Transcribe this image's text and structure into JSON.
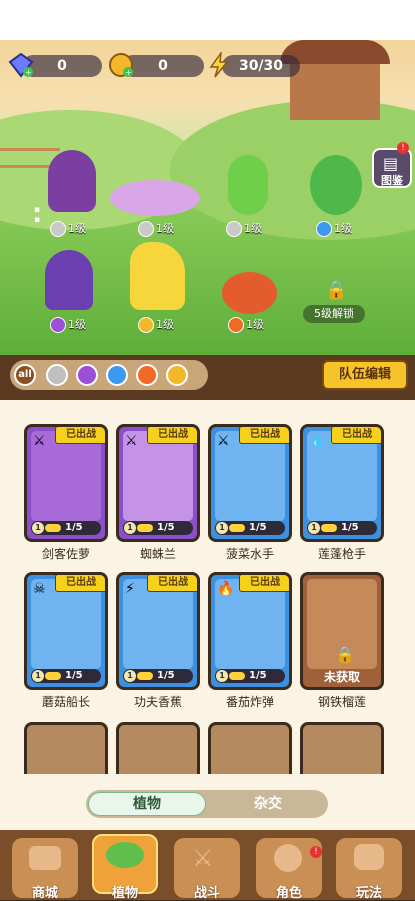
{
  "resources": {
    "diamonds": "0",
    "coins": "0",
    "energy": "30/30"
  },
  "scene": {
    "book_label": "图鉴",
    "lock_text": "5级解锁",
    "slots": [
      {
        "level": "1级",
        "element": "steel"
      },
      {
        "level": "1级",
        "element": "steel"
      },
      {
        "level": "1级",
        "element": "steel"
      },
      {
        "level": "1级",
        "element": "water"
      },
      {
        "level": "1级",
        "element": "poison"
      },
      {
        "level": "1级",
        "element": "electric"
      },
      {
        "level": "1级",
        "element": "fire"
      }
    ]
  },
  "filter": {
    "all_label": "all",
    "team_edit": "队伍编辑"
  },
  "cards": [
    {
      "name": "剑客佐萝",
      "tag": "已出战",
      "level": "1",
      "count": "1/5",
      "element": "steel",
      "color": "#8a4fc9"
    },
    {
      "name": "蜘蛛兰",
      "tag": "已出战",
      "level": "1",
      "count": "1/5",
      "element": "steel",
      "color": "#8a4fc9"
    },
    {
      "name": "菠菜水手",
      "tag": "已出战",
      "level": "1",
      "count": "1/5",
      "element": "steel",
      "color": "#3d8fe0"
    },
    {
      "name": "莲蓬枪手",
      "tag": "已出战",
      "level": "1",
      "count": "1/5",
      "element": "water",
      "color": "#3d8fe0"
    },
    {
      "name": "蘑菇船长",
      "tag": "已出战",
      "level": "1",
      "count": "1/5",
      "element": "poison",
      "color": "#3d8fe0"
    },
    {
      "name": "功夫香蕉",
      "tag": "已出战",
      "level": "1",
      "count": "1/5",
      "element": "electric",
      "color": "#3d8fe0"
    },
    {
      "name": "番茄炸弹",
      "tag": "已出战",
      "level": "1",
      "count": "1/5",
      "element": "fire",
      "color": "#3d8fe0"
    },
    {
      "name": "钢铁榴莲",
      "lock": "未获取",
      "color": "#a0603a"
    }
  ],
  "toggle": {
    "plants": "植物",
    "hybrid": "杂交"
  },
  "nav": [
    {
      "label": "商城"
    },
    {
      "label": "植物"
    },
    {
      "label": "战斗"
    },
    {
      "label": "角色"
    },
    {
      "label": "玩法"
    }
  ]
}
